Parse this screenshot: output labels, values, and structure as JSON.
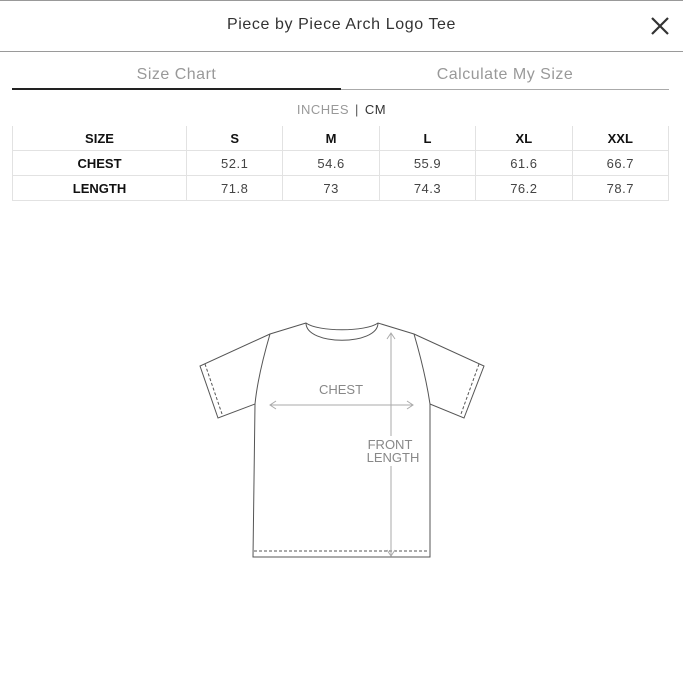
{
  "header": {
    "title": "Piece by Piece Arch Logo Tee"
  },
  "tabs": [
    {
      "label": "Size Chart"
    },
    {
      "label": "Calculate My Size"
    }
  ],
  "units": {
    "inches": "INCHES",
    "separator": "|",
    "cm": "CM"
  },
  "table": {
    "columns": [
      "SIZE",
      "S",
      "M",
      "L",
      "XL",
      "XXL"
    ],
    "rows": [
      {
        "label": "CHEST",
        "values": [
          "52.1",
          "54.6",
          "55.9",
          "61.6",
          "66.7"
        ]
      },
      {
        "label": "LENGTH",
        "values": [
          "71.8",
          "73",
          "74.3",
          "76.2",
          "78.7"
        ]
      }
    ]
  },
  "diagram": {
    "chest_label": "CHEST",
    "length_label_line1": "FRONT",
    "length_label_line2": "LENGTH"
  },
  "icons": {
    "close": "close-icon"
  }
}
